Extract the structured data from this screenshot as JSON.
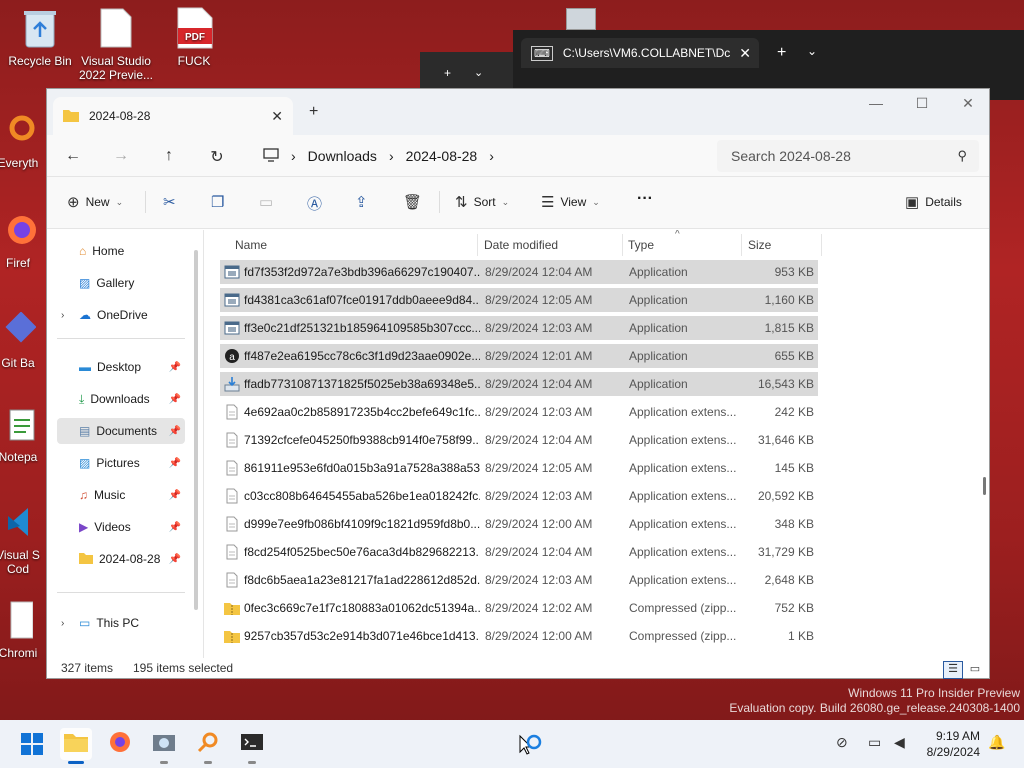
{
  "desktop": {
    "icons": [
      {
        "label": "Recycle Bin"
      },
      {
        "label": "Visual Studio 2022 Previe..."
      },
      {
        "label": "FUCK"
      },
      {
        "label": "Everyth"
      },
      {
        "label": "Firef"
      },
      {
        "label": "Git Ba"
      },
      {
        "label": "Notepa"
      },
      {
        "label": "Visual S Cod"
      },
      {
        "label": "Chromi"
      }
    ]
  },
  "terminal": {
    "tab_title": "C:\\Users\\VM6.COLLABNET\\Dc"
  },
  "explorer": {
    "tab_title": "2024-08-28",
    "breadcrumb": [
      "Downloads",
      "2024-08-28"
    ],
    "search_placeholder": "Search 2024-08-28",
    "toolbar": {
      "new_label": "New",
      "sort_label": "Sort",
      "view_label": "View",
      "details_label": "Details"
    },
    "sidebar": {
      "items": [
        {
          "label": "Home"
        },
        {
          "label": "Gallery"
        },
        {
          "label": "OneDrive"
        },
        {
          "label": "Desktop"
        },
        {
          "label": "Downloads"
        },
        {
          "label": "Documents"
        },
        {
          "label": "Pictures"
        },
        {
          "label": "Music"
        },
        {
          "label": "Videos"
        },
        {
          "label": "2024-08-28"
        },
        {
          "label": "This PC"
        }
      ]
    },
    "columns": [
      "Name",
      "Date modified",
      "Type",
      "Size"
    ],
    "files": [
      {
        "name": "fd7f353f2d972a7e3bdb396a66297c190407...",
        "date": "8/29/2024 12:04 AM",
        "type": "Application",
        "size": "953 KB",
        "icon": "exe",
        "selected": true
      },
      {
        "name": "fd4381ca3c61af07fce01917ddb0aeee9d84...",
        "date": "8/29/2024 12:05 AM",
        "type": "Application",
        "size": "1,160 KB",
        "icon": "exe",
        "selected": true
      },
      {
        "name": "ff3e0c21df251321b185964109585b307ccc...",
        "date": "8/29/2024 12:03 AM",
        "type": "Application",
        "size": "1,815 KB",
        "icon": "exe",
        "selected": true
      },
      {
        "name": "ff487e2ea6195cc78c6c3f1d9d23aae0902e...",
        "date": "8/29/2024 12:01 AM",
        "type": "Application",
        "size": "655 KB",
        "icon": "exe-dark",
        "selected": true
      },
      {
        "name": "ffadb77310871371825f5025eb38a69348e5...",
        "date": "8/29/2024 12:04 AM",
        "type": "Application",
        "size": "16,543 KB",
        "icon": "installer",
        "selected": true
      },
      {
        "name": "4e692aa0c2b858917235b4cc2befe649c1fc...",
        "date": "8/29/2024 12:03 AM",
        "type": "Application extens...",
        "size": "242 KB",
        "icon": "dll",
        "selected": false
      },
      {
        "name": "71392cfcefe045250fb9388cb914f0e758f99...",
        "date": "8/29/2024 12:04 AM",
        "type": "Application extens...",
        "size": "31,646 KB",
        "icon": "dll",
        "selected": false
      },
      {
        "name": "861911e953e6fd0a015b3a91a7528a388a53...",
        "date": "8/29/2024 12:05 AM",
        "type": "Application extens...",
        "size": "145 KB",
        "icon": "dll",
        "selected": false
      },
      {
        "name": "c03cc808b64645455aba526be1ea018242fc...",
        "date": "8/29/2024 12:03 AM",
        "type": "Application extens...",
        "size": "20,592 KB",
        "icon": "dll",
        "selected": false
      },
      {
        "name": "d999e7ee9fb086bf4109f9c1821d959fd8b0...",
        "date": "8/29/2024 12:00 AM",
        "type": "Application extens...",
        "size": "348 KB",
        "icon": "dll",
        "selected": false
      },
      {
        "name": "f8cd254f0525bec50e76aca3d4b829682213...",
        "date": "8/29/2024 12:04 AM",
        "type": "Application extens...",
        "size": "31,729 KB",
        "icon": "dll",
        "selected": false
      },
      {
        "name": "f8dc6b5aea1a23e81217fa1ad228612d852d...",
        "date": "8/29/2024 12:03 AM",
        "type": "Application extens...",
        "size": "2,648 KB",
        "icon": "dll",
        "selected": false
      },
      {
        "name": "0fec3c669c7e1f7c180883a01062dc51394a...",
        "date": "8/29/2024 12:02 AM",
        "type": "Compressed (zipp...",
        "size": "752 KB",
        "icon": "zip",
        "selected": false
      },
      {
        "name": "9257cb357d53c2e914b3d071e46bce1d413...",
        "date": "8/29/2024 12:00 AM",
        "type": "Compressed (zipp...",
        "size": "1 KB",
        "icon": "zip",
        "selected": false
      }
    ],
    "status": {
      "item_count": "327 items",
      "selected_count": "195 items selected"
    }
  },
  "watermark": {
    "line1": "Windows 11 Pro Insider Preview",
    "line2": "Evaluation copy. Build 26080.ge_release.240308-1400"
  },
  "taskbar": {
    "time": "9:19 AM",
    "date": "8/29/2024"
  },
  "colors": {
    "accent": "#0b61c4",
    "desktop_bg": "#a82222",
    "selection": "#d9d9d9"
  }
}
